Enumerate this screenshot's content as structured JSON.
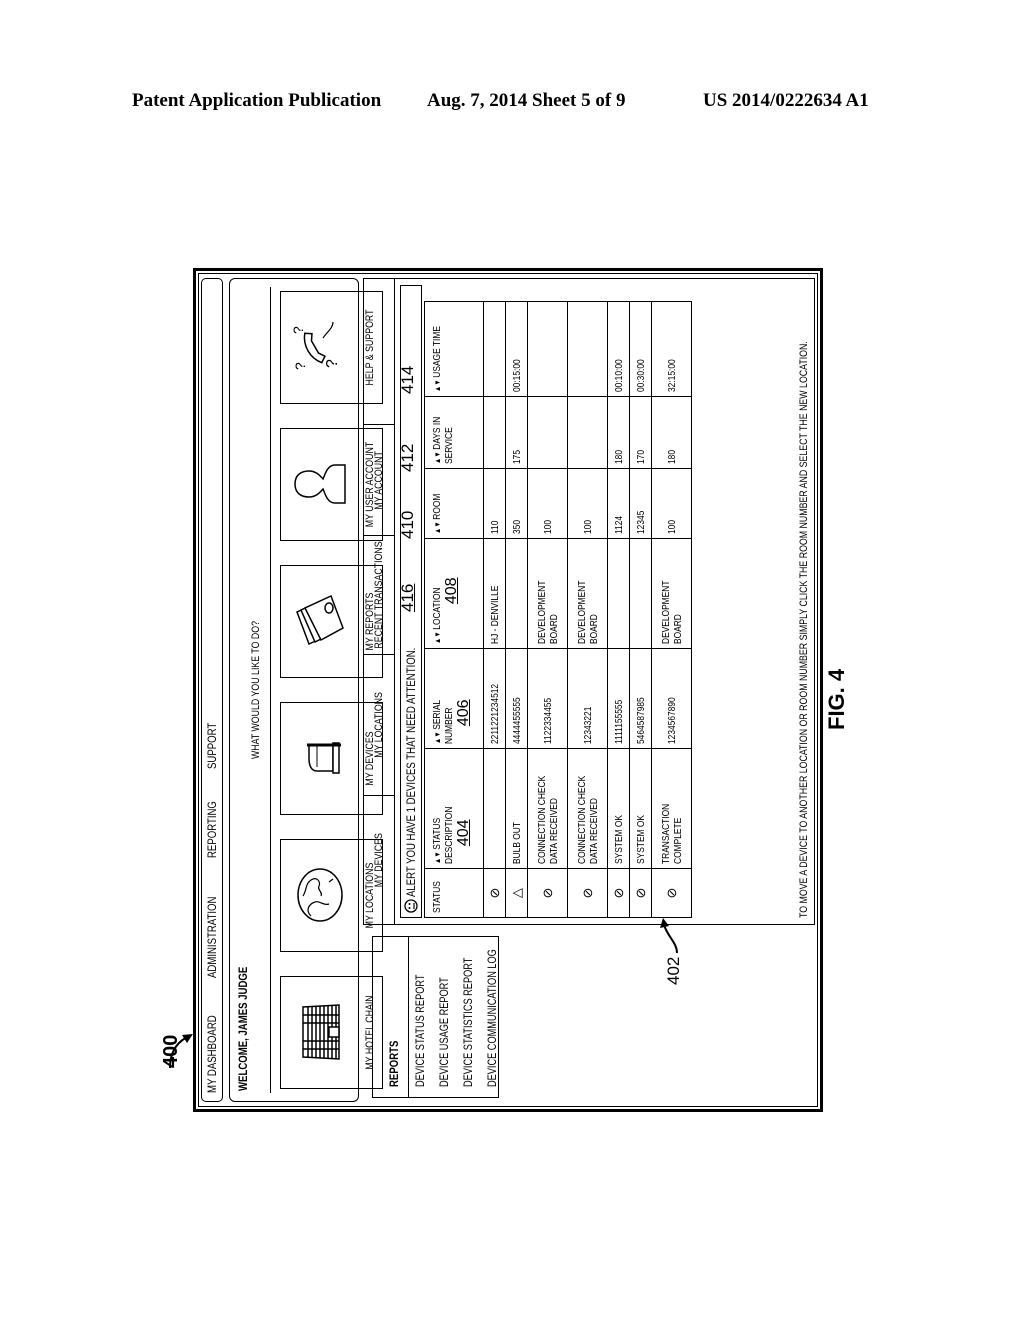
{
  "header": {
    "left": "Patent Application Publication",
    "middle": "Aug. 7, 2014   Sheet 5 of 9",
    "right": "US 2014/0222634 A1"
  },
  "figure": {
    "label": "FIG. 4",
    "ref_main": "400",
    "ref_reports": "402",
    "refs": {
      "status_description": "404",
      "serial_number": "406",
      "location": "408",
      "room": "410",
      "days_in_service": "412",
      "usage_time": "414",
      "alert": "416"
    }
  },
  "navbar": {
    "items": [
      "MY DASHBOARD",
      "ADMINISTRATION",
      "REPORTING",
      "SUPPORT"
    ]
  },
  "welcome": {
    "title": "WELCOME, JAMES JUDGE",
    "question": "WHAT WOULD YOU LIKE TO DO?",
    "tiles": [
      {
        "label": "MY HOTEL CHAIN",
        "icon": "hotel-building-icon"
      },
      {
        "label": "MY LOCATIONS",
        "icon": "globe-icon"
      },
      {
        "label": "MY DEVICES",
        "icon": "device-icon"
      },
      {
        "label": "MY REPORTS",
        "icon": "reports-stack-icon"
      },
      {
        "label": "MY USER ACCOUNT",
        "icon": "user-silhouette-icon"
      },
      {
        "label": "HELP & SUPPORT",
        "icon": "telephone-question-icon"
      }
    ]
  },
  "reports": {
    "title": "REPORTS",
    "items": [
      "DEVICE STATUS REPORT",
      "DEVICE USAGE REPORT",
      "DEVICE STATISTICS REPORT",
      "DEVICE COMMUNICATION LOG"
    ]
  },
  "main": {
    "tabs": [
      "MY DEVICES",
      "MY LOCATIONS",
      "RECENT TRANSACTIONS",
      "MY ACCOUNT"
    ],
    "alert": "ALERT YOU HAVE 1 DEVICES THAT NEED ATTENTION.",
    "columns": {
      "status": "STATUS",
      "status_description": "STATUS DESCRIPTION",
      "serial_number": "SERIAL NUMBER",
      "location": "LOCATION",
      "room": "ROOM",
      "days_in_service": "DAYS IN SERVICE",
      "usage_time": "USAGE TIME"
    },
    "rows": [
      {
        "status": "ok",
        "description": "",
        "serial": "2211221234512",
        "location": "HJ - DENVILLE",
        "room": "110",
        "days": "",
        "usage": ""
      },
      {
        "status": "warning",
        "description": "BULB OUT",
        "serial": "4444455555",
        "location": "",
        "room": "350",
        "days": "175",
        "usage": "00:15:00"
      },
      {
        "status": "ok",
        "description": "CONNECTION CHECK DATA RECEIVED",
        "serial": "1122334455",
        "location": "DEVELOPMENT BOARD",
        "room": "100",
        "days": "",
        "usage": ""
      },
      {
        "status": "ok",
        "description": "CONNECTION CHECK DATA RECEIVED",
        "serial": "12343221",
        "location": "DEVELOPMENT BOARD",
        "room": "100",
        "days": "",
        "usage": ""
      },
      {
        "status": "ok",
        "description": "SYSTEM OK",
        "serial": "1111155555",
        "location": "",
        "room": "1124",
        "days": "180",
        "usage": "00:10:00"
      },
      {
        "status": "ok",
        "description": "SYSTEM OK",
        "serial": "5464587985",
        "location": "",
        "room": "12345",
        "days": "170",
        "usage": "00:30:00"
      },
      {
        "status": "ok",
        "description": "TRANSACTION COMPLETE",
        "serial": "1234567890",
        "location": "DEVELOPMENT BOARD",
        "room": "100",
        "days": "180",
        "usage": "32:15:00"
      }
    ],
    "note": "TO MOVE A DEVICE TO ANOTHER LOCATION OR ROOM NUMBER SIMPLY CLICK THE ROOM NUMBER AND SELECT THE NEW LOCATION."
  }
}
